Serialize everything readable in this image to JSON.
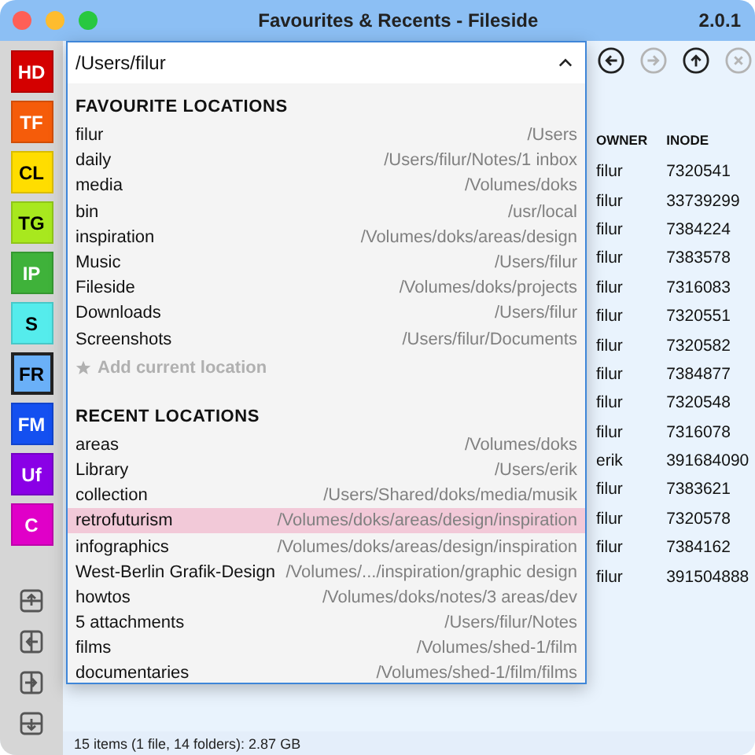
{
  "window": {
    "title": "Favourites & Recents - Fileside",
    "version": "2.0.1"
  },
  "sidebar": {
    "favorites": [
      {
        "label": "HD",
        "color": "#d40000",
        "selected": false
      },
      {
        "label": "TF",
        "color": "#f55c0a",
        "selected": false
      },
      {
        "label": "CL",
        "color": "#ffdd00",
        "selected": false
      },
      {
        "label": "TG",
        "color": "#a8e81e",
        "selected": false
      },
      {
        "label": "IP",
        "color": "#3fb23a",
        "selected": false
      },
      {
        "label": "S",
        "color": "#55ecec",
        "selected": false
      },
      {
        "label": "FR",
        "color": "#6ab0f8",
        "selected": true
      },
      {
        "label": "FM",
        "color": "#1450f0",
        "selected": false
      },
      {
        "label": "Uf",
        "color": "#8a00e6",
        "selected": false
      },
      {
        "label": "C",
        "color": "#e000c8",
        "selected": false
      }
    ]
  },
  "nav_buttons": [
    {
      "kind": "back",
      "disabled": false
    },
    {
      "kind": "forward",
      "disabled": true
    },
    {
      "kind": "up",
      "disabled": false
    },
    {
      "kind": "stop",
      "disabled": true
    }
  ],
  "path_field": {
    "value": "/Users/filur",
    "expanded": true
  },
  "dropdown": {
    "sections": [
      {
        "heading": "FAVOURITE LOCATIONS",
        "items": [
          {
            "name": "filur",
            "path": "/Users",
            "selected": false
          },
          {
            "name": "daily",
            "path": "/Users/filur/Notes/1 inbox",
            "selected": false
          },
          {
            "name": "media",
            "path": "/Volumes/doks",
            "selected": false
          },
          {
            "name": "bin",
            "path": "/usr/local",
            "selected": false
          },
          {
            "name": "inspiration",
            "path": "/Volumes/doks/areas/design",
            "selected": false
          },
          {
            "name": "Music",
            "path": "/Users/filur",
            "selected": false
          },
          {
            "name": "Fileside",
            "path": "/Volumes/doks/projects",
            "selected": false
          },
          {
            "name": "Downloads",
            "path": "/Users/filur",
            "selected": false
          },
          {
            "name": "Screenshots",
            "path": "/Users/filur/Documents",
            "selected": false
          }
        ],
        "action": {
          "label": "Add current location",
          "disabled": true
        }
      },
      {
        "heading": "RECENT LOCATIONS",
        "items": [
          {
            "name": "areas",
            "path": "/Volumes/doks",
            "selected": false
          },
          {
            "name": "Library",
            "path": "/Users/erik",
            "selected": false
          },
          {
            "name": "collection",
            "path": "/Users/Shared/doks/media/musik",
            "selected": false
          },
          {
            "name": "retrofuturism",
            "path": "/Volumes/doks/areas/design/inspiration",
            "selected": true
          },
          {
            "name": "infographics",
            "path": "/Volumes/doks/areas/design/inspiration",
            "selected": false
          },
          {
            "name": "West-Berlin Grafik-Design",
            "path": "/Volumes/.../inspiration/graphic design",
            "selected": false
          },
          {
            "name": "howtos",
            "path": "/Volumes/doks/notes/3 areas/dev",
            "selected": false
          },
          {
            "name": "5 attachments",
            "path": "/Users/filur/Notes",
            "selected": false
          },
          {
            "name": "films",
            "path": "/Volumes/shed-1/film",
            "selected": false
          },
          {
            "name": "documentaries",
            "path": "/Volumes/shed-1/film/films",
            "selected": false
          }
        ]
      }
    ]
  },
  "table": {
    "columns": [
      "OWNER",
      "INODE"
    ],
    "rows": [
      [
        "filur",
        "7320541"
      ],
      [
        "filur",
        "33739299"
      ],
      [
        "filur",
        "7384224"
      ],
      [
        "filur",
        "7383578"
      ],
      [
        "filur",
        "7316083"
      ],
      [
        "filur",
        "7320551"
      ],
      [
        "filur",
        "7320582"
      ],
      [
        "filur",
        "7384877"
      ],
      [
        "filur",
        "7320548"
      ],
      [
        "filur",
        "7316078"
      ],
      [
        "erik",
        "391684090"
      ],
      [
        "filur",
        "7383621"
      ],
      [
        "filur",
        "7320578"
      ],
      [
        "filur",
        "7384162"
      ],
      [
        "filur",
        "391504888"
      ]
    ]
  },
  "status_bar": "15 items (1 file, 14 folders): 2.87 GB"
}
